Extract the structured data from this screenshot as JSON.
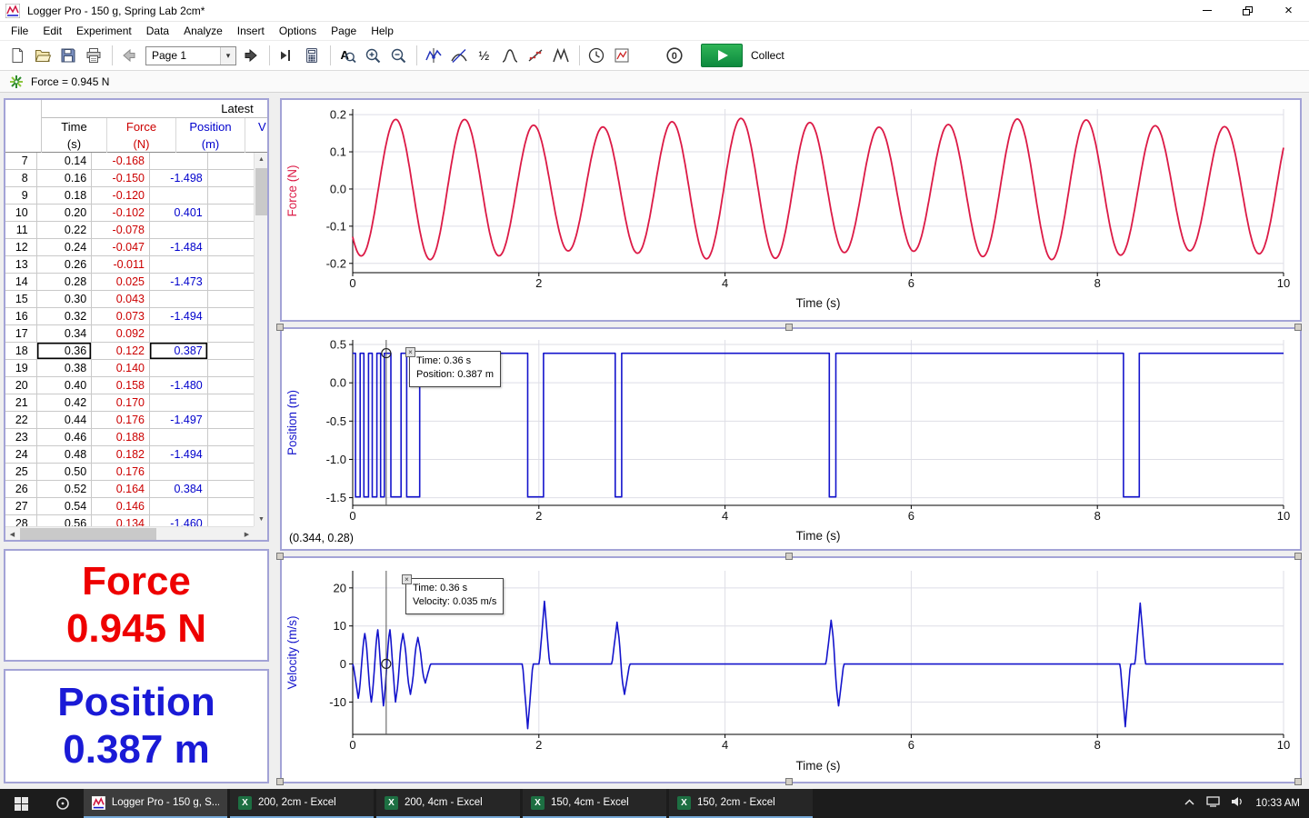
{
  "window": {
    "title": "Logger Pro - 150 g, Spring Lab 2cm*"
  },
  "menu": {
    "items": [
      "File",
      "Edit",
      "Experiment",
      "Data",
      "Analyze",
      "Insert",
      "Options",
      "Page",
      "Help"
    ]
  },
  "toolbar": {
    "page_select": "Page 1",
    "collect_label": "Collect",
    "items": [
      "new-file-icon",
      "open-folder-icon",
      "save-icon",
      "print-icon",
      "sep",
      "back-arrow-icon",
      "page-dropdown",
      "forward-arrow-icon",
      "sep",
      "goto-page-icon",
      "calculator-icon",
      "sep",
      "autoscale-icon",
      "zoom-in-icon",
      "zoom-out-icon",
      "sep",
      "examine-icon",
      "tangent-icon",
      "integral-icon",
      "statistics-icon",
      "linear-fit-icon",
      "curve-fit-icon",
      "sep",
      "clock-icon",
      "graph-options-icon",
      "gap",
      "zero-icon",
      "collect-button"
    ]
  },
  "status": {
    "sensor_readout": "Force = 0.945 N"
  },
  "table": {
    "title": "Latest",
    "selected_row": 18,
    "columns": [
      {
        "name": "Time",
        "unit": "(s)",
        "color": "#000000"
      },
      {
        "name": "Force",
        "unit": "(N)",
        "color": "#cc0000"
      },
      {
        "name": "Position",
        "unit": "(m)",
        "color": "#0000cc"
      },
      {
        "name": "V",
        "unit": "",
        "color": "#0000cc"
      }
    ],
    "rows": [
      [
        7,
        "0.14",
        "-0.168",
        ""
      ],
      [
        8,
        "0.16",
        "-0.150",
        "-1.498"
      ],
      [
        9,
        "0.18",
        "-0.120",
        ""
      ],
      [
        10,
        "0.20",
        "-0.102",
        "0.401"
      ],
      [
        11,
        "0.22",
        "-0.078",
        ""
      ],
      [
        12,
        "0.24",
        "-0.047",
        "-1.484"
      ],
      [
        13,
        "0.26",
        "-0.011",
        ""
      ],
      [
        14,
        "0.28",
        "0.025",
        "-1.473"
      ],
      [
        15,
        "0.30",
        "0.043",
        ""
      ],
      [
        16,
        "0.32",
        "0.073",
        "-1.494"
      ],
      [
        17,
        "0.34",
        "0.092",
        ""
      ],
      [
        18,
        "0.36",
        "0.122",
        "0.387"
      ],
      [
        19,
        "0.38",
        "0.140",
        ""
      ],
      [
        20,
        "0.40",
        "0.158",
        "-1.480"
      ],
      [
        21,
        "0.42",
        "0.170",
        ""
      ],
      [
        22,
        "0.44",
        "0.176",
        "-1.497"
      ],
      [
        23,
        "0.46",
        "0.188",
        ""
      ],
      [
        24,
        "0.48",
        "0.182",
        "-1.494"
      ],
      [
        25,
        "0.50",
        "0.176",
        ""
      ],
      [
        26,
        "0.52",
        "0.164",
        "0.384"
      ],
      [
        27,
        "0.54",
        "0.146",
        ""
      ],
      [
        28,
        "0.56",
        "0.134",
        "-1.460"
      ]
    ]
  },
  "meters": {
    "force": {
      "label": "Force",
      "value": "0.945 N",
      "color": "#ee0000"
    },
    "position": {
      "label": "Position",
      "value": "0.387 m",
      "color": "#1a1ad6"
    }
  },
  "chart_data": [
    {
      "id": "force",
      "type": "line",
      "series_name": "Force vs Time",
      "xlabel": "Time (s)",
      "ylabel": "Force (N)",
      "color": "#dc1a46",
      "xlim": [
        0,
        10
      ],
      "ylim": [
        -0.225,
        0.215
      ],
      "xticks": [
        0,
        2,
        4,
        6,
        8,
        10
      ],
      "yticks": [
        0.2,
        0.1,
        0,
        -0.1,
        -0.2
      ],
      "ytick_labels": [
        "0.2",
        "0.1",
        "0.0",
        "-0.1",
        "-0.2"
      ],
      "grid": true,
      "signal": {
        "kind": "sine",
        "amplitude": 0.178,
        "amplitude_mod": 0.012,
        "amplitude_mod_period": 3.3,
        "period": 0.742,
        "t_of_min": 0.09
      }
    },
    {
      "id": "position",
      "type": "line",
      "series_name": "Position vs Time",
      "xlabel": "Time (s)",
      "ylabel": "Position (m)",
      "color": "#1414cc",
      "xlim": [
        0,
        10
      ],
      "ylim": [
        -1.6,
        0.56
      ],
      "xticks": [
        0,
        2,
        4,
        6,
        8,
        10
      ],
      "yticks": [
        0.5,
        0,
        -0.5,
        -1,
        -1.5
      ],
      "ytick_labels": [
        "0.5",
        "0.0",
        "-0.5",
        "-1.0",
        "-1.5"
      ],
      "grid": true,
      "signal": {
        "kind": "pulse",
        "baseline": 0.385,
        "low": -1.49,
        "dropouts": [
          [
            0.03,
            0.08
          ],
          [
            0.12,
            0.17
          ],
          [
            0.21,
            0.26
          ],
          [
            0.3,
            0.34
          ],
          [
            0.41,
            0.52
          ],
          [
            0.58,
            0.72
          ],
          [
            1.88,
            2.05
          ],
          [
            2.82,
            2.89
          ],
          [
            5.12,
            5.19
          ],
          [
            8.28,
            8.45
          ]
        ]
      },
      "examine": {
        "t": 0.36,
        "value": 0.387,
        "tooltip": [
          "Time: 0.36 s",
          "Position: 0.387 m"
        ]
      },
      "coord_readout": "(0.344, 0.28)"
    },
    {
      "id": "velocity",
      "type": "line",
      "series_name": "Velocity vs Time",
      "xlabel": "Time (s)",
      "ylabel": "Velocity (m/s)",
      "color": "#1414cc",
      "xlim": [
        0,
        10
      ],
      "ylim": [
        -18.5,
        24.5
      ],
      "xticks": [
        0,
        2,
        4,
        6,
        8,
        10
      ],
      "yticks": [
        20,
        10,
        0,
        -10
      ],
      "ytick_labels": [
        "20",
        "10",
        "0",
        "-10"
      ],
      "grid": true,
      "signal": {
        "kind": "spikes",
        "baseline": 0,
        "half_width": 0.055,
        "spikes": [
          [
            0.06,
            -9
          ],
          [
            0.13,
            8
          ],
          [
            0.2,
            -10
          ],
          [
            0.27,
            9
          ],
          [
            0.33,
            -11
          ],
          [
            0.4,
            9
          ],
          [
            0.46,
            -10
          ],
          [
            0.54,
            8
          ],
          [
            0.62,
            -8
          ],
          [
            0.7,
            7
          ],
          [
            0.78,
            -5
          ],
          [
            1.88,
            -17
          ],
          [
            2.06,
            16.5
          ],
          [
            2.84,
            11
          ],
          [
            2.92,
            -8
          ],
          [
            5.14,
            11.5
          ],
          [
            5.22,
            -11
          ],
          [
            8.3,
            -16.5
          ],
          [
            8.46,
            16
          ]
        ]
      },
      "examine": {
        "t": 0.36,
        "value": 0.035,
        "tooltip": [
          "Time: 0.36 s",
          "Velocity: 0.035 m/s"
        ]
      }
    }
  ],
  "taskbar": {
    "apps": [
      {
        "label": "Logger Pro - 150 g, S...",
        "icon": "loggerpro-icon",
        "active": true
      },
      {
        "label": "200, 2cm - Excel",
        "icon": "excel-icon",
        "active": false
      },
      {
        "label": "200, 4cm - Excel",
        "icon": "excel-icon",
        "active": false
      },
      {
        "label": "150, 4cm - Excel",
        "icon": "excel-icon",
        "active": false
      },
      {
        "label": "150, 2cm - Excel",
        "icon": "excel-icon",
        "active": false
      }
    ],
    "clock": "10:33 AM"
  }
}
